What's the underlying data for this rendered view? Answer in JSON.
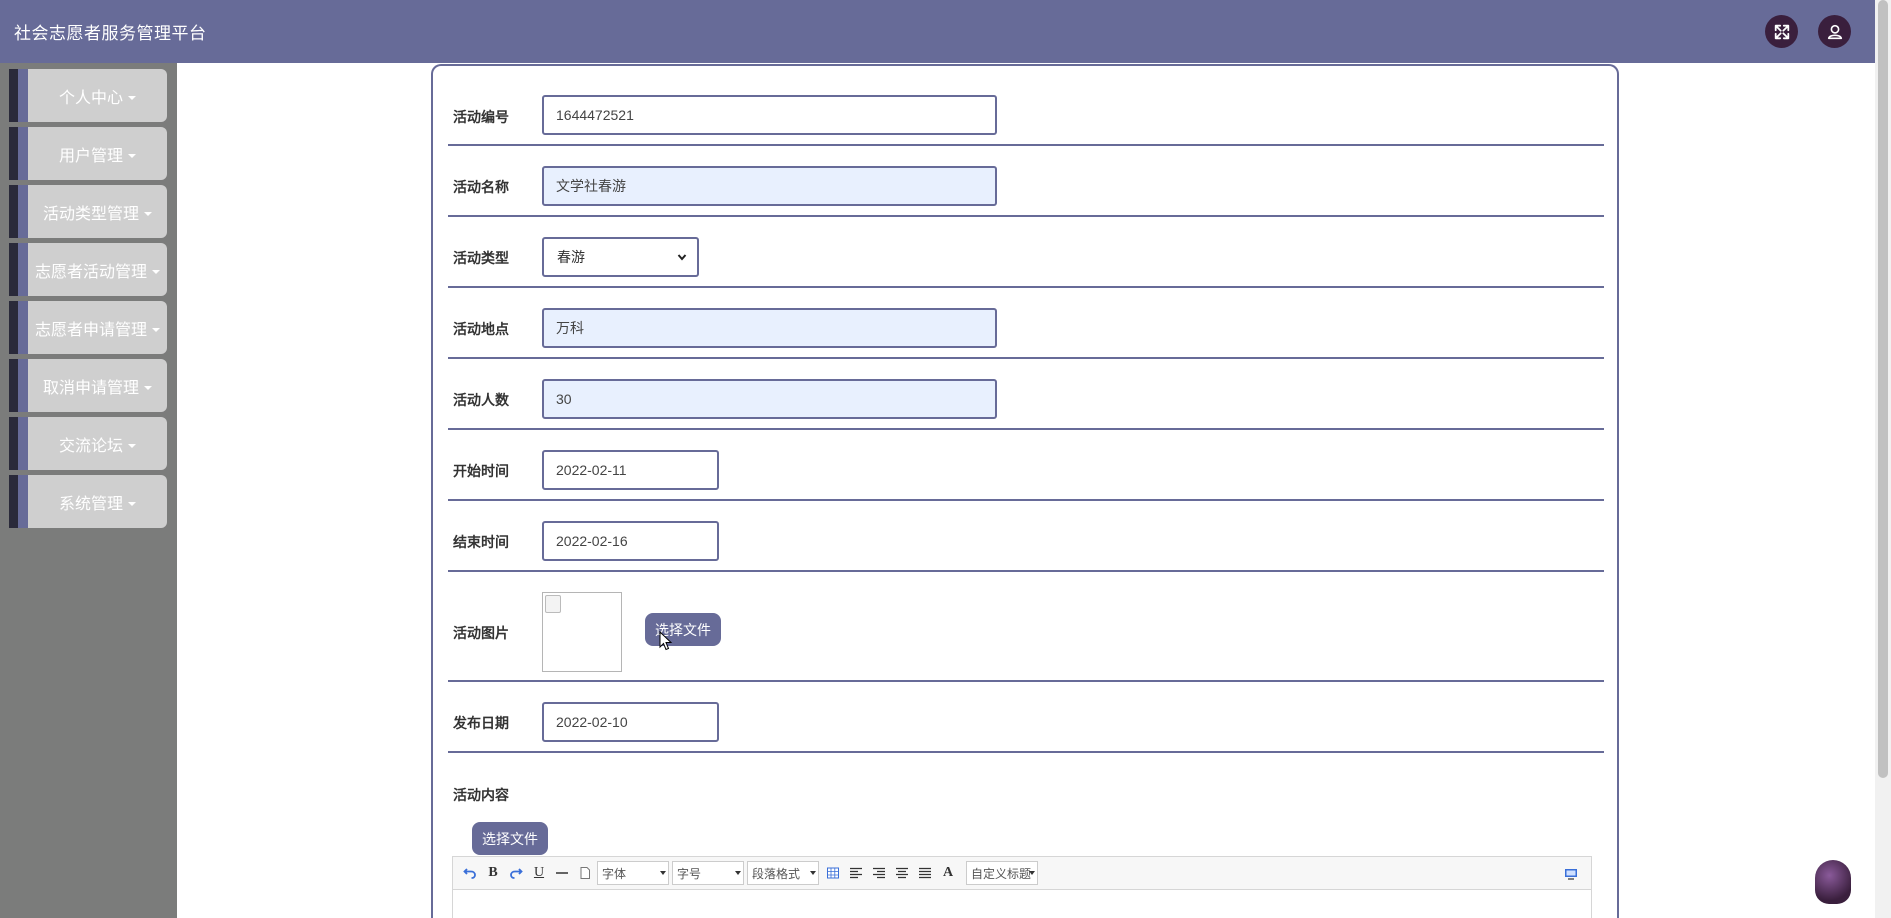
{
  "app": {
    "title": "社会志愿者服务管理平台"
  },
  "header": {
    "fullscreen_icon": "fullscreen-icon",
    "user_icon": "user-icon"
  },
  "sidebar": {
    "items": [
      {
        "label": "个人中心"
      },
      {
        "label": "用户管理"
      },
      {
        "label": "活动类型管理"
      },
      {
        "label": "志愿者活动管理"
      },
      {
        "label": "志愿者申请管理"
      },
      {
        "label": "取消申请管理"
      },
      {
        "label": "交流论坛"
      },
      {
        "label": "系统管理"
      }
    ]
  },
  "form": {
    "activity_no": {
      "label": "活动编号",
      "value": "1644472521"
    },
    "activity_name": {
      "label": "活动名称",
      "value": "文学社春游"
    },
    "activity_type": {
      "label": "活动类型",
      "value": "春游"
    },
    "location": {
      "label": "活动地点",
      "value": "万科"
    },
    "headcount": {
      "label": "活动人数",
      "value": "30"
    },
    "start_time": {
      "label": "开始时间",
      "value": "2022-02-11"
    },
    "end_time": {
      "label": "结束时间",
      "value": "2022-02-16"
    },
    "image": {
      "label": "活动图片",
      "button": "选择文件"
    },
    "publish_date": {
      "label": "发布日期",
      "value": "2022-02-10"
    },
    "content": {
      "label": "活动内容",
      "button": "选择文件"
    }
  },
  "editor": {
    "font_family": "字体",
    "font_size": "字号",
    "paragraph": "段落格式",
    "custom_title": "自定义标题",
    "bold": "B",
    "underline": "U",
    "font_color": "A"
  },
  "colors": {
    "accent": "#676b98",
    "sidebar_bg": "#7b7c7b",
    "header_icon_bg": "#3a1f3d"
  }
}
